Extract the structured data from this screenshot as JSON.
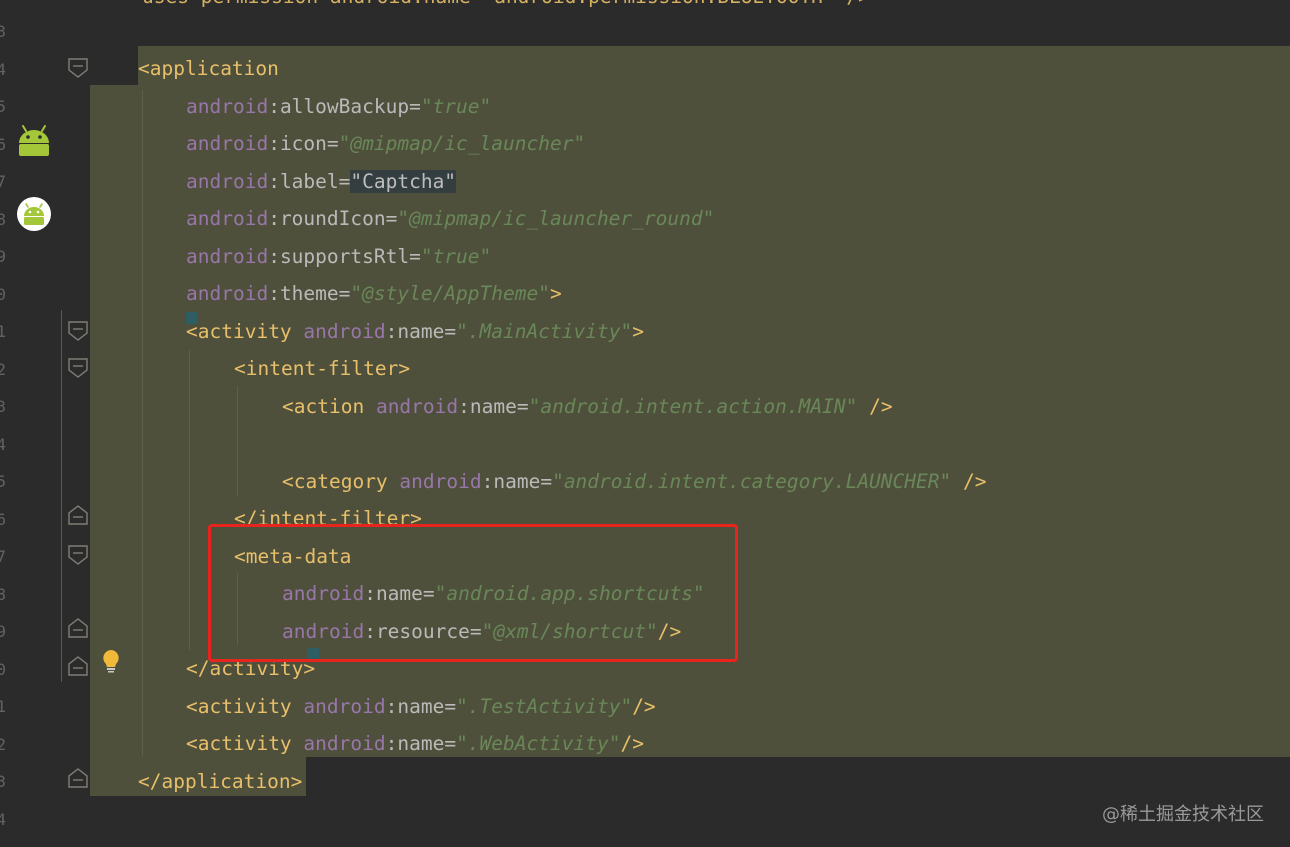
{
  "gutter": {
    "line_numbers": [
      "3",
      "4",
      "5",
      "6",
      "7",
      "8",
      "9",
      "0",
      "1",
      "2",
      "3",
      "4",
      "5",
      "6",
      "7",
      "8",
      "9",
      "0",
      "1",
      "2",
      "3",
      "4"
    ]
  },
  "code": {
    "top_partial": "uses-permission android:name=\"android.permission.BLUETOOTH\" />",
    "lines": [
      [
        {
          "t": "<",
          "c": "t-br"
        },
        {
          "t": "application",
          "c": "t-tag"
        }
      ],
      [
        {
          "t": "android",
          "c": "t-ns"
        },
        {
          "t": ":",
          "c": "t-punc"
        },
        {
          "t": "allowBackup",
          "c": "t-attr"
        },
        {
          "t": "=",
          "c": "t-eq"
        },
        {
          "t": "\"true\"",
          "c": "t-val"
        }
      ],
      [
        {
          "t": "android",
          "c": "t-ns"
        },
        {
          "t": ":",
          "c": "t-punc"
        },
        {
          "t": "icon",
          "c": "t-attr"
        },
        {
          "t": "=",
          "c": "t-eq"
        },
        {
          "t": "\"@mipmap/ic_launcher\"",
          "c": "t-val"
        }
      ],
      [
        {
          "t": "android",
          "c": "t-ns"
        },
        {
          "t": ":",
          "c": "t-punc"
        },
        {
          "t": "label",
          "c": "t-attr"
        },
        {
          "t": "=",
          "c": "t-eq"
        },
        {
          "t": "\"Captcha\"",
          "c": "sel-label"
        }
      ],
      [
        {
          "t": "android",
          "c": "t-ns"
        },
        {
          "t": ":",
          "c": "t-punc"
        },
        {
          "t": "roundIcon",
          "c": "t-attr"
        },
        {
          "t": "=",
          "c": "t-eq"
        },
        {
          "t": "\"@mipmap/ic_launcher_round\"",
          "c": "t-val"
        }
      ],
      [
        {
          "t": "android",
          "c": "t-ns"
        },
        {
          "t": ":",
          "c": "t-punc"
        },
        {
          "t": "supportsRtl",
          "c": "t-attr"
        },
        {
          "t": "=",
          "c": "t-eq"
        },
        {
          "t": "\"true\"",
          "c": "t-val"
        }
      ],
      [
        {
          "t": "android",
          "c": "t-ns"
        },
        {
          "t": ":",
          "c": "t-punc"
        },
        {
          "t": "theme",
          "c": "t-attr"
        },
        {
          "t": "=",
          "c": "t-eq"
        },
        {
          "t": "\"@style/AppTheme\"",
          "c": "t-val"
        },
        {
          "t": ">",
          "c": "t-br"
        }
      ],
      [
        {
          "t": "<",
          "c": "t-br"
        },
        {
          "t": "activity",
          "c": "t-tag"
        },
        {
          "t": " ",
          "c": "t-punc"
        },
        {
          "t": "android",
          "c": "t-ns"
        },
        {
          "t": ":",
          "c": "t-punc"
        },
        {
          "t": "name",
          "c": "t-attr"
        },
        {
          "t": "=",
          "c": "t-eq"
        },
        {
          "t": "\".MainActivity\"",
          "c": "t-val"
        },
        {
          "t": ">",
          "c": "t-br"
        }
      ],
      [
        {
          "t": "<",
          "c": "t-br"
        },
        {
          "t": "intent-filter",
          "c": "t-tag"
        },
        {
          "t": ">",
          "c": "t-br"
        }
      ],
      [
        {
          "t": "<",
          "c": "t-br"
        },
        {
          "t": "action",
          "c": "t-tag"
        },
        {
          "t": " ",
          "c": "t-punc"
        },
        {
          "t": "android",
          "c": "t-ns"
        },
        {
          "t": ":",
          "c": "t-punc"
        },
        {
          "t": "name",
          "c": "t-attr"
        },
        {
          "t": "=",
          "c": "t-eq"
        },
        {
          "t": "\"android.intent.action.MAIN\"",
          "c": "t-val"
        },
        {
          "t": " />",
          "c": "t-br"
        }
      ],
      [],
      [
        {
          "t": "<",
          "c": "t-br"
        },
        {
          "t": "category",
          "c": "t-tag"
        },
        {
          "t": " ",
          "c": "t-punc"
        },
        {
          "t": "android",
          "c": "t-ns"
        },
        {
          "t": ":",
          "c": "t-punc"
        },
        {
          "t": "name",
          "c": "t-attr"
        },
        {
          "t": "=",
          "c": "t-eq"
        },
        {
          "t": "\"android.intent.category.LAUNCHER\"",
          "c": "t-val"
        },
        {
          "t": " />",
          "c": "t-br"
        }
      ],
      [
        {
          "t": "</",
          "c": "t-br"
        },
        {
          "t": "intent-filter",
          "c": "t-tag"
        },
        {
          "t": ">",
          "c": "t-br"
        }
      ],
      [
        {
          "t": "<",
          "c": "t-br"
        },
        {
          "t": "meta-data",
          "c": "t-tag"
        }
      ],
      [
        {
          "t": "android",
          "c": "t-ns"
        },
        {
          "t": ":",
          "c": "t-punc"
        },
        {
          "t": "name",
          "c": "t-attr"
        },
        {
          "t": "=",
          "c": "t-eq"
        },
        {
          "t": "\"android.app.shortcuts\"",
          "c": "t-val"
        }
      ],
      [
        {
          "t": "android",
          "c": "t-ns"
        },
        {
          "t": ":",
          "c": "t-punc"
        },
        {
          "t": "resource",
          "c": "t-attr"
        },
        {
          "t": "=",
          "c": "t-eq"
        },
        {
          "t": "\"@xml/shortcut\"",
          "c": "t-val"
        },
        {
          "t": "/>",
          "c": "t-br"
        }
      ],
      [
        {
          "t": "</",
          "c": "t-br"
        },
        {
          "t": "activity",
          "c": "t-tag"
        },
        {
          "t": ">",
          "c": "t-br"
        }
      ],
      [
        {
          "t": "<",
          "c": "t-br"
        },
        {
          "t": "activity",
          "c": "t-tag"
        },
        {
          "t": " ",
          "c": "t-punc"
        },
        {
          "t": "android",
          "c": "t-ns"
        },
        {
          "t": ":",
          "c": "t-punc"
        },
        {
          "t": "name",
          "c": "t-attr"
        },
        {
          "t": "=",
          "c": "t-eq"
        },
        {
          "t": "\".TestActivity\"",
          "c": "t-val"
        },
        {
          "t": "/>",
          "c": "t-br"
        }
      ],
      [
        {
          "t": "<",
          "c": "t-br"
        },
        {
          "t": "activity",
          "c": "t-tag"
        },
        {
          "t": " ",
          "c": "t-punc"
        },
        {
          "t": "android",
          "c": "t-ns"
        },
        {
          "t": ":",
          "c": "t-punc"
        },
        {
          "t": "name",
          "c": "t-attr"
        },
        {
          "t": "=",
          "c": "t-eq"
        },
        {
          "t": "\".WebActivity\"",
          "c": "t-val"
        },
        {
          "t": "/>",
          "c": "t-br"
        }
      ],
      [
        {
          "t": "</",
          "c": "t-br"
        },
        {
          "t": "application",
          "c": "t-tag"
        },
        {
          "t": ">",
          "c": "t-br"
        }
      ]
    ]
  },
  "icons": {
    "android_icon": "android-icon",
    "android_round_icon": "android-round-icon",
    "bulb": "lightbulb-icon",
    "fold": "fold-icon"
  },
  "colors": {
    "background": "#2b2b2b",
    "highlight": "#4f503b",
    "tag": "#e8bf6a",
    "namespace": "#9876aa",
    "attribute": "#bababa",
    "value": "#6a8759",
    "red_box": "#e8241f",
    "android_green": "#a4c639"
  },
  "watermark": "@稀土掘金技术社区"
}
